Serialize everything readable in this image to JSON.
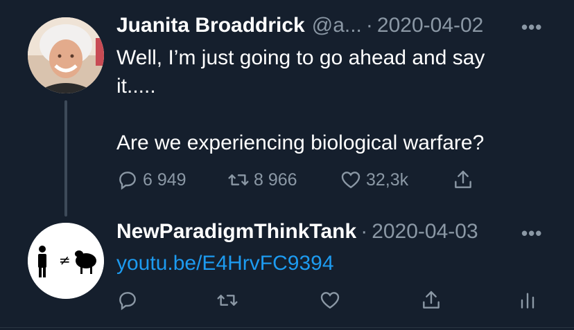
{
  "tweets": [
    {
      "name": "Juanita Broaddrick",
      "handle": "@a...",
      "separator": "·",
      "date": "2020-04-02",
      "more": "•••",
      "text": "Well, I’m just going to go ahead and say\nit.....\n\nAre we experiencing biological warfare?",
      "actions": {
        "replies": "6 949",
        "retweets": "8 966",
        "likes": "32,3k"
      }
    },
    {
      "name": "NewParadigmThinkTank",
      "separator": "·",
      "date": "2020-04-03",
      "more": "•••",
      "link": "youtu.be/E4HrvFC9394",
      "avatar_symbol": "≠"
    }
  ],
  "icons": [
    "reply-icon",
    "retweet-icon",
    "like-icon",
    "share-icon",
    "analytics-icon"
  ],
  "colors": {
    "background": "#151f2d",
    "text": "#ffffff",
    "muted": "#8b98a5",
    "link": "#1d9bf0"
  }
}
